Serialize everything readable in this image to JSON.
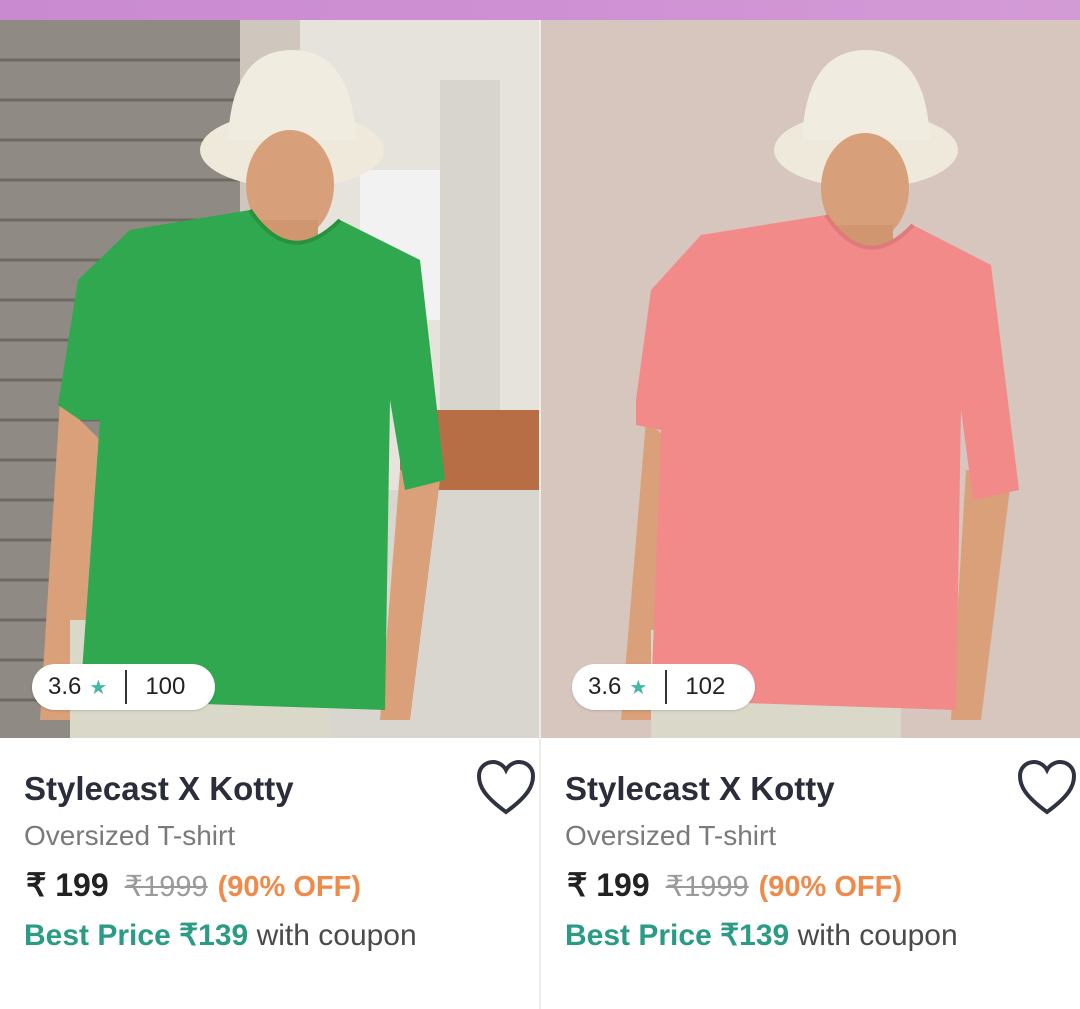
{
  "colors": {
    "accent_bar": "#cf90d3",
    "best_price": "#2a9b84",
    "discount": "#ef8a4a",
    "star": "#44b7a5",
    "shirt_left": "#2fa84f",
    "shirt_right": "#f28a8a"
  },
  "products": [
    {
      "image_alt": "green-oversized-tshirt-photo",
      "rating": "3.6",
      "rating_count": "100",
      "brand": "Stylecast X Kotty",
      "subtitle": "Oversized T-shirt",
      "price": "₹ 199",
      "mrp": "₹1999",
      "discount": "(90% OFF)",
      "best_price_label": "Best Price ₹139",
      "best_price_tail": " with coupon",
      "icons": {
        "star": "star-icon",
        "wishlist": "heart-outline-icon"
      }
    },
    {
      "image_alt": "pink-oversized-tshirt-photo",
      "rating": "3.6",
      "rating_count": "102",
      "brand": "Stylecast X Kotty",
      "subtitle": "Oversized T-shirt",
      "price": "₹ 199",
      "mrp": "₹1999",
      "discount": "(90% OFF)",
      "best_price_label": "Best Price ₹139",
      "best_price_tail": " with coupon",
      "icons": {
        "star": "star-icon",
        "wishlist": "heart-outline-icon"
      }
    }
  ]
}
